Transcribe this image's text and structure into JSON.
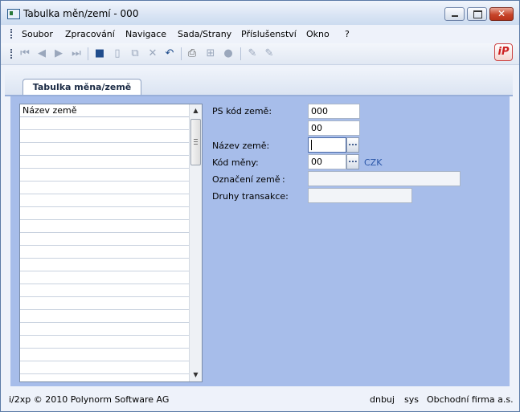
{
  "window": {
    "title": "Tabulka měn/zemí - 000"
  },
  "menu": [
    "Soubor",
    "Zpracování",
    "Navigace",
    "Sada/Strany",
    "Příslušenství",
    "Okno",
    "?"
  ],
  "toolbar_icons": [
    "first-record-icon",
    "previous-record-icon",
    "next-record-icon",
    "last-record-icon",
    "save-icon",
    "new-document-icon",
    "copy-icon",
    "delete-icon",
    "undo-icon",
    "print-icon",
    "tree-icon",
    "circle-icon",
    "edit-pen-icon",
    "edit-pen-2-icon"
  ],
  "tab": {
    "label": "Tabulka měna/země"
  },
  "list": {
    "header": "Název země",
    "rows": 20
  },
  "form": {
    "ps_kod_zeme_label": "PS kód země:",
    "ps_kod_zeme_value": "000",
    "ps_kod_zeme_value2": "00",
    "nazev_zeme_label": "Název země:",
    "nazev_zeme_value": "",
    "kod_meny_label": "Kód měny:",
    "kod_meny_value": "00",
    "currency_code": "CZK",
    "oznaceni_zeme_label": "Označení země",
    "oznaceni_zeme_colon": ":",
    "oznaceni_zeme_value": "",
    "druhy_transakce_label": "Druhy transakce:",
    "druhy_transakce_value": "",
    "ellipsis": "..."
  },
  "status": {
    "copyright": "i/2xp © 2010 Polynorm Software AG",
    "user": "dnbuj",
    "system": "sys",
    "company": "Obchodní firma a.s."
  },
  "colors": {
    "panel": "#a7bdea",
    "currency": "#2a56a8",
    "close_button": "#c7452b"
  }
}
